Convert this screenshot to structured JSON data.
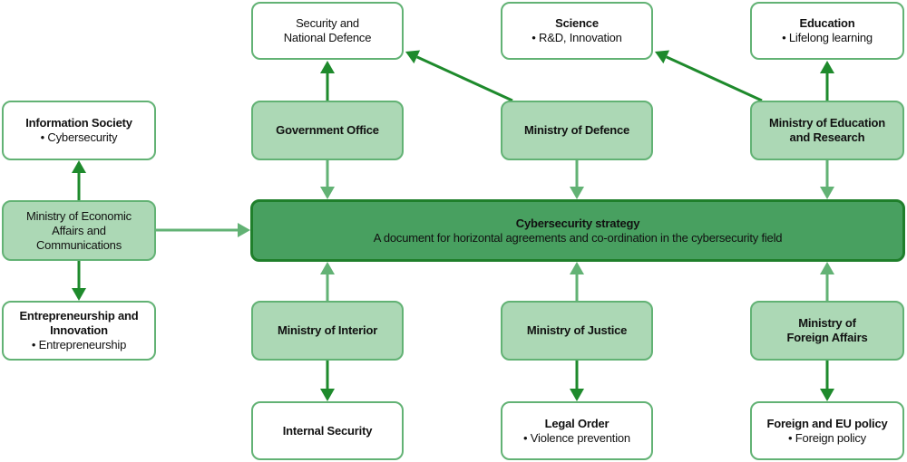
{
  "colors": {
    "ministry_fill": "#acd8b5",
    "box_border": "#62b274",
    "central_fill": "#48a060",
    "central_border": "#1f7f2b",
    "dark_arrow": "#1e8a2c",
    "light_arrow": "#62b274"
  },
  "central": {
    "title": "Cybersecurity strategy",
    "subtitle": "A document for horizontal agreements and co-ordination in the cybersecurity field"
  },
  "left": {
    "ministry": "Ministry of Economic\nAffairs and\nCommunications",
    "top": {
      "title": "Information Society",
      "item": "• Cybersecurity"
    },
    "bottom": {
      "title": "Entrepreneurship and\nInnovation",
      "item": "• Entrepreneurship"
    }
  },
  "top": [
    {
      "ministry": "Government Office",
      "area": {
        "title": "",
        "item": "Security and\nNational Defence"
      }
    },
    {
      "ministry": "Ministry of Defence",
      "area": {
        "title": "Science",
        "item": "• R&D, Innovation"
      }
    },
    {
      "ministry": "Ministry of Education\nand Research",
      "area": {
        "title": "Education",
        "item": "• Lifelong learning"
      }
    }
  ],
  "bottom": [
    {
      "ministry": "Ministry of Interior",
      "area": {
        "title": "Internal Security",
        "item": ""
      }
    },
    {
      "ministry": "Ministry of Justice",
      "area": {
        "title": "Legal Order",
        "item": "• Violence prevention"
      }
    },
    {
      "ministry": "Ministry of\nForeign Affairs",
      "area": {
        "title": "Foreign and EU policy",
        "item": "• Foreign policy"
      }
    }
  ]
}
